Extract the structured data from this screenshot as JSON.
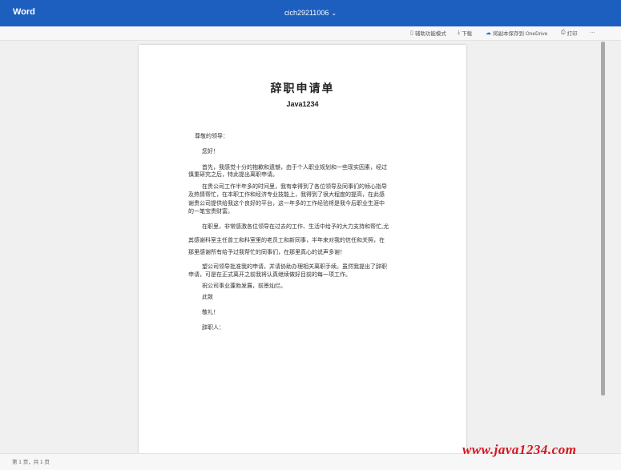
{
  "app": {
    "name": "Word"
  },
  "document": {
    "title": "cich29211006"
  },
  "toolbar": {
    "items": [
      {
        "label": "辅助功能模式",
        "icon": "document-icon"
      },
      {
        "label": "下载",
        "icon": "download-icon"
      },
      {
        "label": "将副本保存到 OneDrive",
        "icon": "cloud-icon"
      },
      {
        "label": "打印",
        "icon": "print-icon"
      },
      {
        "label": "…",
        "icon": "more-icon"
      }
    ]
  },
  "content": {
    "heading": "辞职申请单",
    "subheading": "Java1234",
    "lines": [
      "尊敬的领导：",
      "您好！",
      "首先，我感觉十分的抱歉和遗憾，由于个人职业规划和一些现实因素，经过",
      "慎重研究之后，特此提出离职申请。",
      "在贵公司工作半年多的时间里，我有幸得到了各位领导及同事们的倾心指导",
      "及热情帮忙，在本职工作和经济专业技能上，我得到了很大程度的提高，在此感",
      "谢贵公司提供给我这个良好的平台，这一年多的工作经验将是我今后职业生涯中",
      "的一笔宝贵财富。",
      "在职里，非常感激各位领导在过去的工作、生活中给予的大力支持和帮忙,尤",
      "其感谢科室主任曾工和科室里的老员工和新同事，半年来对我的信任和关照，在",
      "那里感谢所有给予过我帮忙的同事们，在那里真心的说声多谢！",
      "望公司领导批准我的申请，并请协助办理相关离职手续。虽然我提出了辞职",
      "申请，可是在正式离开之前我将认真继续做好目前的每一项工作。",
      "祝公司事业蓬勃发展，前景灿烂。",
      "此致",
      "敬礼！",
      "辞职人："
    ]
  },
  "status": {
    "text": "第 1 页，共 1 页"
  },
  "watermark": {
    "text": "www.java1234.com"
  }
}
